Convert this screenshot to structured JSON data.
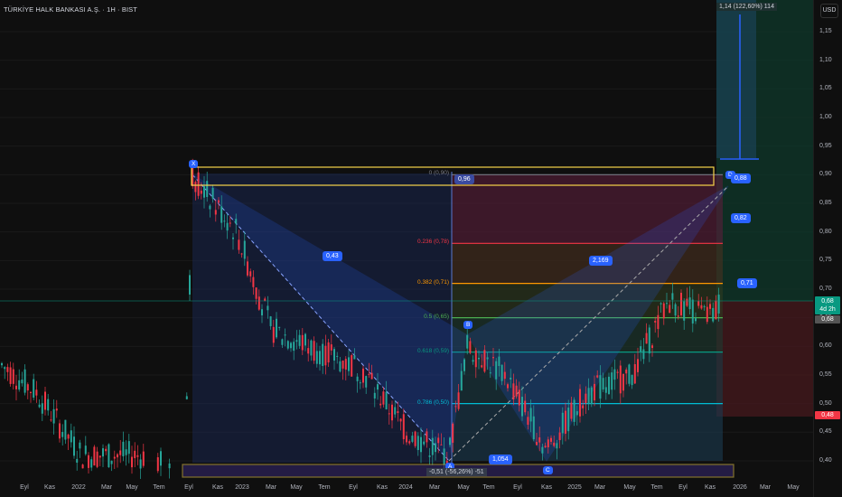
{
  "header": {
    "title": "TÜRKİYE HALK BANKASI A.Ş. · 1H · BIST",
    "currency": "USD"
  },
  "price_axis": {
    "ticks": [
      "1,15",
      "1,10",
      "1,05",
      "1,00",
      "0,95",
      "0,90",
      "0,85",
      "0,80",
      "0,75",
      "0,70",
      "0,65",
      "0,60",
      "0,55",
      "0,50",
      "0,45",
      "0,40"
    ],
    "last_price": "0,68",
    "countdown": "4d 2h",
    "prev_close": "0,68",
    "stop_price": "0,48"
  },
  "time_axis": {
    "labels": [
      "Eyl",
      "Kas",
      "2022",
      "Mar",
      "May",
      "Tem",
      "Eyl",
      "Kas",
      "2023",
      "Mar",
      "May",
      "Tem",
      "Eyl",
      "Kas",
      "2024",
      "Mar",
      "May",
      "Tem",
      "Eyl",
      "Kas",
      "2025",
      "Mar",
      "May",
      "Tem",
      "Eyl",
      "Kas",
      "2026",
      "Mar",
      "May"
    ]
  },
  "pattern": {
    "points": [
      {
        "name": "X",
        "price": 0.9
      },
      {
        "name": "A",
        "price": 0.4
      },
      {
        "name": "B",
        "price": 0.62
      },
      {
        "name": "C",
        "price": 0.4
      },
      {
        "name": "D",
        "price": 0.88
      }
    ],
    "ratios": {
      "xab": "0,43",
      "abc": "1,054",
      "bcd": "2,169",
      "xad": "0,96"
    }
  },
  "fibonacci": [
    {
      "label": "0 (0,90)",
      "color": "#787b86"
    },
    {
      "label": "0.236 (0,78)",
      "color": "#f23645"
    },
    {
      "label": "0.382 (0,71)",
      "color": "#ff9800"
    },
    {
      "label": "0.5 (0,65)",
      "color": "#4caf50"
    },
    {
      "label": "0.618 (0,59)",
      "color": "#089981"
    },
    {
      "label": "0.786 (0,50)",
      "color": "#00bcd4"
    }
  ],
  "targets": {
    "t1": "0,88",
    "t2": "0,82",
    "t3": "0,71"
  },
  "measure": {
    "top": "1,14 (122,60%) 114",
    "bottom": "-0,51 (-56,26%) -51"
  },
  "colors": {
    "up": "#26a69a",
    "down": "#f23645",
    "accent": "#2962ff"
  }
}
